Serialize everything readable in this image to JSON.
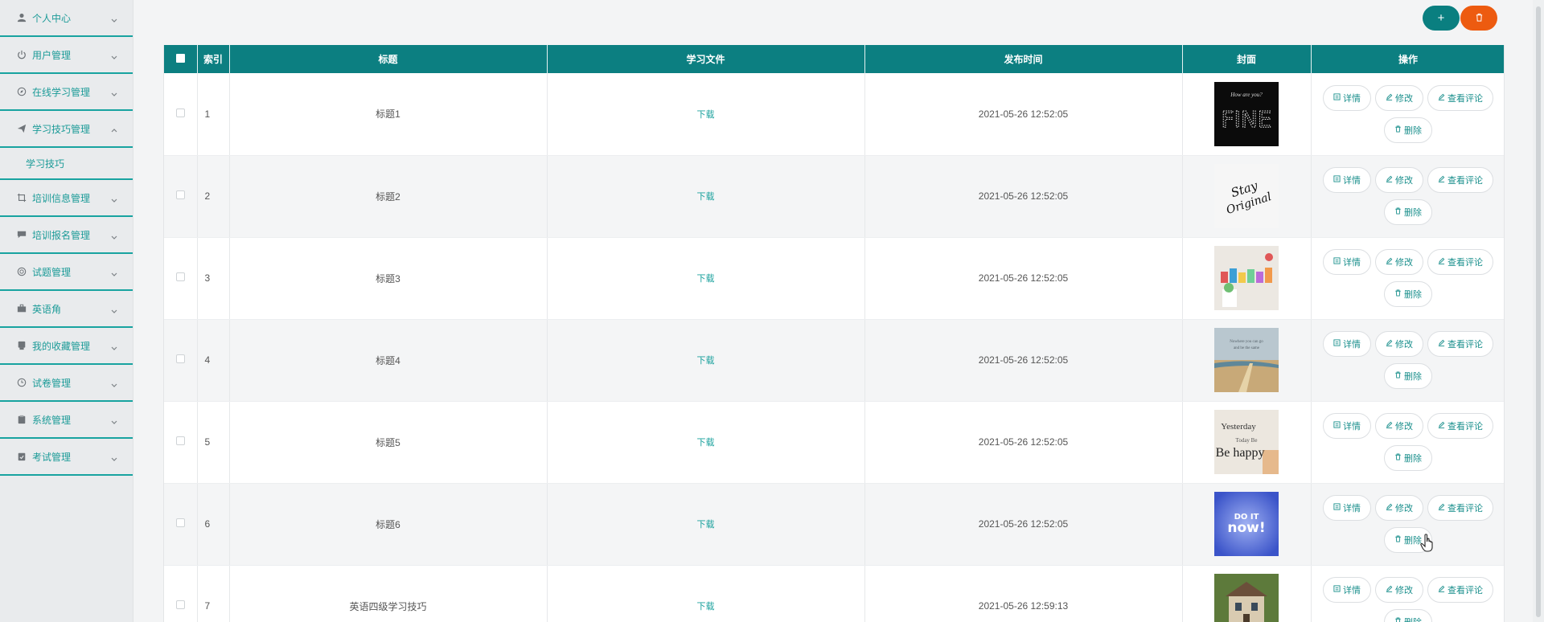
{
  "sidebar": {
    "items": [
      {
        "label": "个人中心",
        "icon": "user-icon"
      },
      {
        "label": "用户管理",
        "icon": "power-icon"
      },
      {
        "label": "在线学习管理",
        "icon": "compass-icon"
      },
      {
        "label": "学习技巧管理",
        "icon": "send-icon",
        "expanded": true,
        "sub": "学习技巧"
      },
      {
        "label": "培训信息管理",
        "icon": "crop-icon"
      },
      {
        "label": "培训报名管理",
        "icon": "chat-icon"
      },
      {
        "label": "试题管理",
        "icon": "globe-icon"
      },
      {
        "label": "英语角",
        "icon": "suitcase-icon"
      },
      {
        "label": "我的收藏管理",
        "icon": "bookmark-icon"
      },
      {
        "label": "试卷管理",
        "icon": "clock-icon"
      },
      {
        "label": "系统管理",
        "icon": "clipboard-icon"
      },
      {
        "label": "考试管理",
        "icon": "clipboard-check-icon"
      }
    ]
  },
  "toolbar": {
    "add_label": "+",
    "add_color": "#0a7f80",
    "delete_color": "#ed5b10"
  },
  "table": {
    "columns": [
      "索引",
      "标题",
      "学习文件",
      "发布时间",
      "封面",
      "操作"
    ],
    "rows": [
      {
        "index": "1",
        "title": "标题1",
        "file": "下载",
        "time": "2021-05-26 12:52:05",
        "cover": "fine-sign"
      },
      {
        "index": "2",
        "title": "标题2",
        "file": "下载",
        "time": "2021-05-26 12:52:05",
        "cover": "stay-original"
      },
      {
        "index": "3",
        "title": "标题3",
        "file": "下载",
        "time": "2021-05-26 12:52:05",
        "cover": "colorful-wall"
      },
      {
        "index": "4",
        "title": "标题4",
        "file": "下载",
        "time": "2021-05-26 12:52:05",
        "cover": "beach"
      },
      {
        "index": "5",
        "title": "标题5",
        "file": "下载",
        "time": "2021-05-26 12:52:05",
        "cover": "be-happy"
      },
      {
        "index": "6",
        "title": "标题6",
        "file": "下载",
        "time": "2021-05-26 12:52:05",
        "cover": "do-it-now"
      },
      {
        "index": "7",
        "title": "英语四级学习技巧",
        "file": "下载",
        "time": "2021-05-26 12:59:13",
        "cover": "house"
      }
    ],
    "actions": {
      "detail": "详情",
      "edit": "修改",
      "comments": "查看评论",
      "delete": "删除"
    }
  }
}
